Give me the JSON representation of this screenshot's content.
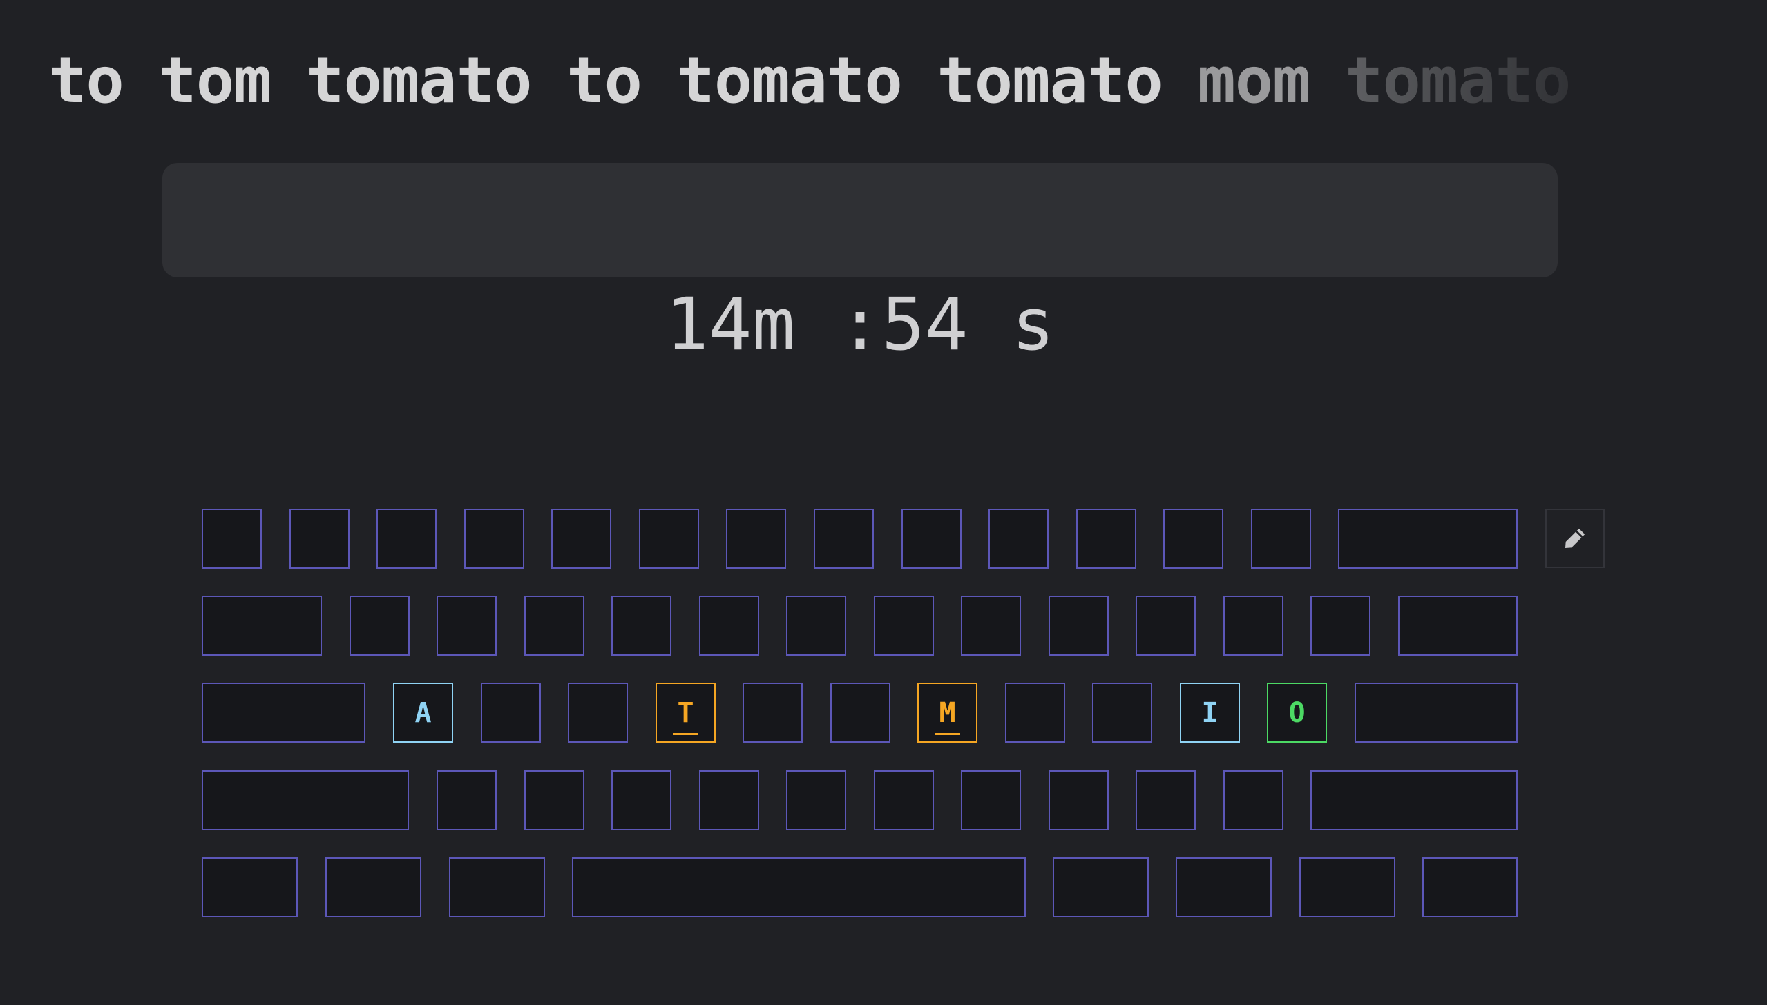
{
  "words": [
    {
      "text": "to",
      "tone": "normal"
    },
    {
      "text": "tom",
      "tone": "normal"
    },
    {
      "text": "tomato",
      "tone": "normal"
    },
    {
      "text": "to",
      "tone": "normal"
    },
    {
      "text": "tomato",
      "tone": "normal"
    },
    {
      "text": "tomato",
      "tone": "normal"
    },
    {
      "text": "mom",
      "tone": "dim"
    },
    {
      "text": "tomato",
      "tone": "faint"
    }
  ],
  "input": {
    "value": "",
    "placeholder": ""
  },
  "timer": {
    "text": "14m :54 s"
  },
  "colors": {
    "background": "#202125",
    "key_border": "#5c57b8",
    "key_fill": "#16171b",
    "text": "#d5d5d6",
    "blue_key": "#8fd3f4",
    "orange_key": "#f5a623",
    "green_key": "#4cd964"
  },
  "keyboard": {
    "rows": [
      [
        {
          "label": ""
        },
        {
          "label": ""
        },
        {
          "label": ""
        },
        {
          "label": ""
        },
        {
          "label": ""
        },
        {
          "label": ""
        },
        {
          "label": ""
        },
        {
          "label": ""
        },
        {
          "label": ""
        },
        {
          "label": ""
        },
        {
          "label": ""
        },
        {
          "label": ""
        },
        {
          "label": ""
        },
        {
          "label": ""
        }
      ],
      [
        {
          "label": ""
        },
        {
          "label": ""
        },
        {
          "label": ""
        },
        {
          "label": ""
        },
        {
          "label": ""
        },
        {
          "label": ""
        },
        {
          "label": ""
        },
        {
          "label": ""
        },
        {
          "label": ""
        },
        {
          "label": ""
        },
        {
          "label": ""
        },
        {
          "label": ""
        },
        {
          "label": ""
        },
        {
          "label": ""
        }
      ],
      [
        {
          "label": ""
        },
        {
          "label": "A",
          "color": "#8fd3f4"
        },
        {
          "label": ""
        },
        {
          "label": ""
        },
        {
          "label": "T",
          "color": "#f5a623",
          "home": true
        },
        {
          "label": ""
        },
        {
          "label": ""
        },
        {
          "label": "M",
          "color": "#f5a623",
          "home": true
        },
        {
          "label": ""
        },
        {
          "label": ""
        },
        {
          "label": "I",
          "color": "#8fd3f4"
        },
        {
          "label": "O",
          "color": "#4cd964"
        },
        {
          "label": ""
        }
      ],
      [
        {
          "label": ""
        },
        {
          "label": ""
        },
        {
          "label": ""
        },
        {
          "label": ""
        },
        {
          "label": ""
        },
        {
          "label": ""
        },
        {
          "label": ""
        },
        {
          "label": ""
        },
        {
          "label": ""
        },
        {
          "label": ""
        },
        {
          "label": ""
        },
        {
          "label": ""
        }
      ],
      [
        {
          "label": ""
        },
        {
          "label": ""
        },
        {
          "label": ""
        },
        {
          "label": ""
        },
        {
          "label": ""
        },
        {
          "label": ""
        },
        {
          "label": ""
        },
        {
          "label": ""
        }
      ]
    ]
  },
  "edit_button": {
    "icon": "pencil-icon"
  }
}
